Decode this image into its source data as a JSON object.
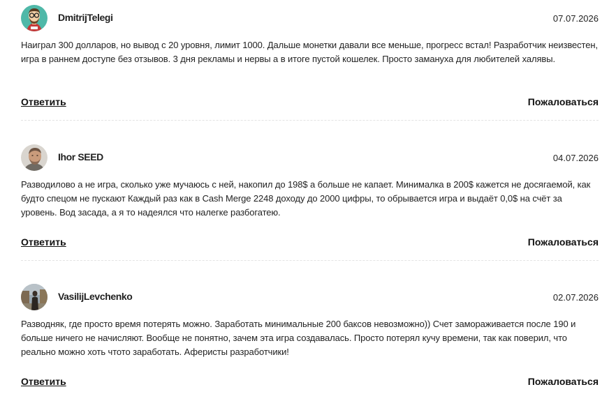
{
  "comments": [
    {
      "author": "DmitrijTelegi",
      "date": "07.07.2026",
      "avatar_icon": "cartoon-man-with-glasses-avatar",
      "text": "Наиграл 300 долларов, но вывод с 20 уровня, лимит 1000. Дальше монетки давали все меньше, прогресс встал! Разработчик неизвестен, игра в раннем доступе без отзывов. 3 дня рекламы и нервы а в итоге пустой кошелек. Просто замануха для любителей халявы.",
      "reply_label": "Ответить",
      "report_label": "Пожаловаться"
    },
    {
      "author": "Ihor SEED",
      "date": "04.07.2026",
      "avatar_icon": "man-photo-avatar",
      "text": "Разводилово а не игра, сколько уже мучаюсь с ней, накопил до 198$ а больше не капает. Минималка в 200$ кажется не досягаемой, как будто спецом не пускают Каждый раз как в Cash Merge 2248 доходу до 2000 цифры, то обрывается игра и выдаёт 0,0$ на счёт за уровень. Вод засада, а я то надеялся что налегке разбогатею.",
      "reply_label": "Ответить",
      "report_label": "Пожаловаться"
    },
    {
      "author": "VasilijLevchenko",
      "date": "02.07.2026",
      "avatar_icon": "person-outdoor-photo-avatar",
      "text": "Разводняк, где просто время потерять можно. Заработать минимальные 200 баксов невозможно)) Счет замораживается после 190 и больше ничего не начисляют. Вообще не понятно, зачем эта игра создавалась. Просто потерял кучу времени, так как поверил, что реально можно хоть чтото заработать. Аферисты разработчики!",
      "reply_label": "Ответить",
      "report_label": "Пожаловаться"
    }
  ],
  "colors": {
    "text": "#222222",
    "divider": "#e3e3e3",
    "background": "#ffffff"
  }
}
